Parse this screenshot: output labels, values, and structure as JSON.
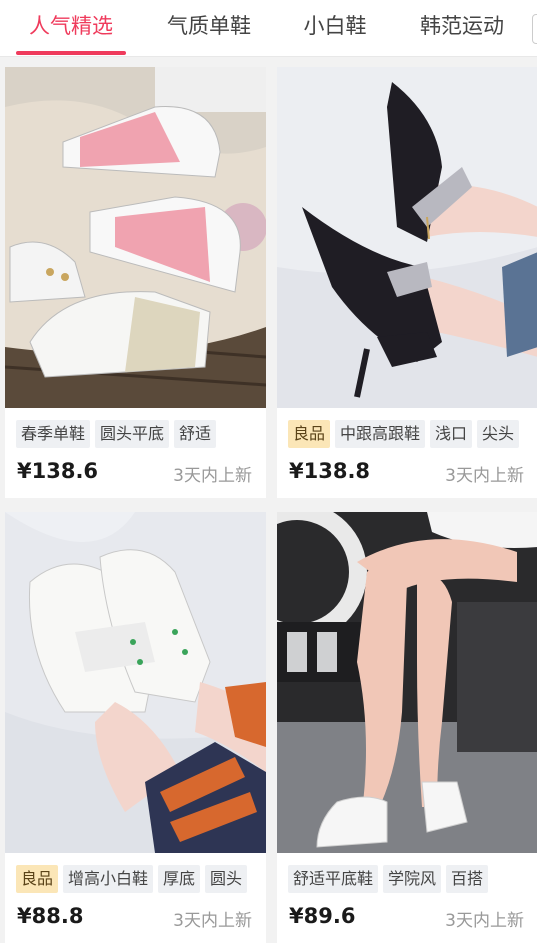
{
  "tabs": [
    {
      "label": "人气精选",
      "active": true
    },
    {
      "label": "气质单鞋",
      "active": false
    },
    {
      "label": "小白鞋",
      "active": false
    },
    {
      "label": "韩范运动",
      "active": false
    }
  ],
  "products": [
    {
      "image": "pink-white-sneakers-photo",
      "tags": [
        {
          "text": "春季单鞋",
          "highlight": false
        },
        {
          "text": "圆头平底",
          "highlight": false
        },
        {
          "text": "舒适",
          "highlight": false
        }
      ],
      "price": "¥138.6",
      "time": "3天内上新"
    },
    {
      "image": "black-suede-pumps-photo",
      "tags": [
        {
          "text": "良品",
          "highlight": true
        },
        {
          "text": "中跟高跟鞋",
          "highlight": false
        },
        {
          "text": "浅口",
          "highlight": false
        },
        {
          "text": "尖头",
          "highlight": false
        }
      ],
      "price": "¥138.8",
      "time": "3天内上新"
    },
    {
      "image": "white-platform-sneakers-photo",
      "tags": [
        {
          "text": "良品",
          "highlight": true
        },
        {
          "text": "增高小白鞋",
          "highlight": false
        },
        {
          "text": "厚底",
          "highlight": false
        },
        {
          "text": "圆头",
          "highlight": false
        }
      ],
      "price": "¥88.8",
      "time": "3天内上新"
    },
    {
      "image": "white-flat-sneakers-legs-photo",
      "tags": [
        {
          "text": "舒适平底鞋",
          "highlight": false
        },
        {
          "text": "学院风",
          "highlight": false
        },
        {
          "text": "百搭",
          "highlight": false
        }
      ],
      "price": "¥89.6",
      "time": "3天内上新"
    }
  ],
  "colors": {
    "accent": "#ef3b5c",
    "tag_bg": "#eef0f3",
    "tag_highlight_bg": "#fbe6b7"
  }
}
